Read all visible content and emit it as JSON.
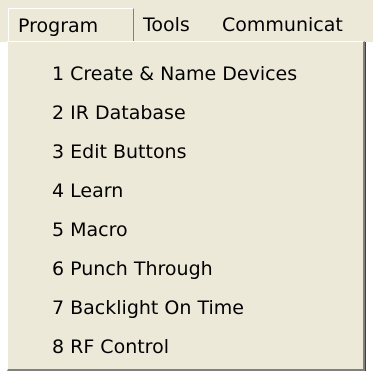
{
  "menubar": {
    "items": [
      {
        "label": "Program"
      },
      {
        "label": "Tools"
      },
      {
        "label": "Communicat"
      }
    ]
  },
  "program_menu": {
    "items": [
      {
        "label": "1 Create & Name Devices"
      },
      {
        "label": "2 IR Database"
      },
      {
        "label": "3 Edit Buttons"
      },
      {
        "label": "4 Learn"
      },
      {
        "label": "5 Macro"
      },
      {
        "label": "6 Punch Through"
      },
      {
        "label": "7 Backlight On Time"
      },
      {
        "label": "8 RF Control"
      }
    ]
  }
}
